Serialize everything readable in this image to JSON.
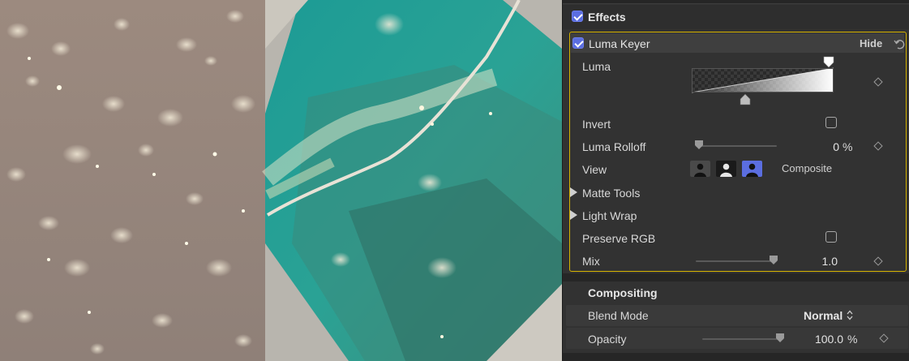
{
  "effects": {
    "title": "Effects",
    "enabled": true
  },
  "luma_keyer": {
    "title": "Luma Keyer",
    "enabled": true,
    "hide_label": "Hide",
    "luma_label": "Luma",
    "invert_label": "Invert",
    "invert_checked": false,
    "luma_rolloff_label": "Luma Rolloff",
    "luma_rolloff_value": "0",
    "luma_rolloff_unit": "%",
    "luma_rolloff_level": 0,
    "view_label": "View",
    "view_mode": "Composite",
    "matte_tools_label": "Matte Tools",
    "light_wrap_label": "Light Wrap",
    "preserve_rgb_label": "Preserve RGB",
    "preserve_rgb_checked": false,
    "mix_label": "Mix",
    "mix_value": "1.0",
    "mix_level": 1.0
  },
  "compositing": {
    "title": "Compositing",
    "blend_mode_label": "Blend Mode",
    "blend_mode_value": "Normal",
    "opacity_label": "Opacity",
    "opacity_value": "100.0",
    "opacity_unit": "%",
    "opacity_level": 1.0
  },
  "colors": {
    "accent": "#5b6ee0",
    "highlight_border": "#d6b300",
    "panel_bg": "#323232"
  },
  "icons": [
    "checkbox-checked",
    "reset-arrow-icon",
    "keyframe-diamond-icon",
    "disclosure-triangle-icon",
    "matte-view-icon",
    "chevron-updown-icon"
  ]
}
